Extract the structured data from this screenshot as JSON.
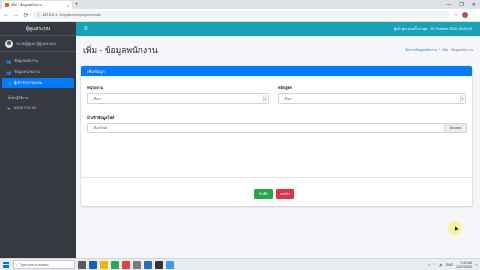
{
  "browser": {
    "tab_title": "เพิ่ม - ข้อมูลพนักงาน",
    "tab_close": "×",
    "new_tab": "+",
    "window_controls": [
      "—",
      "❐",
      "✕"
    ],
    "url_host": "127.0.0.1",
    "url_path": "/hrsystem/employee/create",
    "nav": [
      "←",
      "→",
      "⟳"
    ]
  },
  "sidebar": {
    "brand": "ผู้ดูแลระบบ",
    "user_name": "ระบบผู้ดูแล ผู้ดูแลระบบ",
    "items": [
      {
        "label": "ข้อมูลพนักงาน",
        "icon": "users-icon",
        "glyph": "👥",
        "active": false
      },
      {
        "label": "ข้อมูลหน่วยงาน",
        "icon": "users-icon",
        "glyph": "👥",
        "active": false
      },
      {
        "label": "ผู้เข้ารับการอบรม",
        "icon": "users-icon",
        "glyph": "👥",
        "active": true
      }
    ],
    "section_header": "ตั้งค่าผู้ใช้งาน",
    "logout_label": "ออกจากระบบ"
  },
  "topnav": {
    "menu_glyph": "≡",
    "datetime": "ผู้เข้าสู่ระบบครั้งล่าสุด : 19 October 2020 15:20:09"
  },
  "page": {
    "title": "เพิ่ม - ข้อมูลพนักงาน",
    "breadcrumb": {
      "parent": "จัดการข้อมูลพนักงาน",
      "separator": "/",
      "current": "เพิ่ม - ข้อมูลพนักงาน"
    }
  },
  "form": {
    "card_title": "เพิ่มข้อมูล",
    "field_unit_label": "หน่วยงาน",
    "field_unit_value": "เลือก",
    "field_course_label": "หลักสูตร",
    "field_course_value": "เลือก",
    "file_label": "นำเข้าข้อมูลไฟล์",
    "file_placeholder": "เลือกไฟล์",
    "file_button": "Browse",
    "save_label": "บันทึก",
    "cancel_label": "ยกเลิก"
  },
  "taskbar": {
    "search_placeholder": "Type here to search",
    "time": "7:42 AM",
    "date": "10/27/2020",
    "lang": "ENG"
  },
  "colors": {
    "primary": "#007bff",
    "topnav": "#17a2b8",
    "sidebar": "#343a40",
    "success": "#28a745",
    "danger": "#dc3545"
  }
}
